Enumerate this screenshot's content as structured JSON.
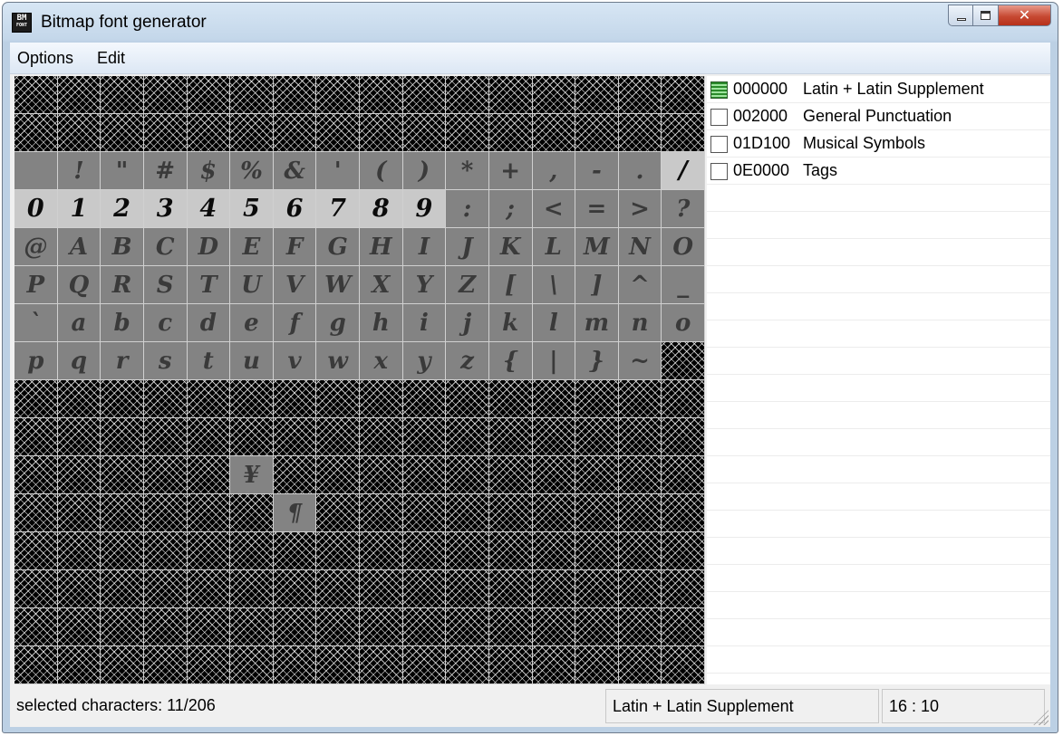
{
  "window": {
    "title": "Bitmap font generator",
    "icon_text_top": "BM",
    "icon_text_bottom": "FONT"
  },
  "menu": [
    "Options",
    "Edit"
  ],
  "grid": {
    "rows": [
      {
        "cells": [
          [
            "",
            ""
          ],
          [
            "",
            ""
          ],
          [
            "",
            ""
          ],
          [
            "",
            ""
          ],
          [
            "",
            ""
          ],
          [
            "",
            ""
          ],
          [
            "",
            ""
          ],
          [
            "",
            ""
          ],
          [
            "",
            ""
          ],
          [
            "",
            ""
          ],
          [
            "",
            ""
          ],
          [
            "",
            ""
          ],
          [
            "",
            ""
          ],
          [
            "",
            ""
          ],
          [
            "",
            ""
          ],
          [
            "",
            ""
          ]
        ]
      },
      {
        "cells": [
          [
            "",
            ""
          ],
          [
            "",
            ""
          ],
          [
            "",
            ""
          ],
          [
            "",
            ""
          ],
          [
            "",
            ""
          ],
          [
            "",
            ""
          ],
          [
            "",
            ""
          ],
          [
            "",
            ""
          ],
          [
            "",
            ""
          ],
          [
            "",
            ""
          ],
          [
            "",
            ""
          ],
          [
            "",
            ""
          ],
          [
            "",
            ""
          ],
          [
            "",
            ""
          ],
          [
            "",
            ""
          ],
          [
            "",
            ""
          ]
        ]
      },
      {
        "cells": [
          [
            "a",
            " "
          ],
          [
            "a",
            "!"
          ],
          [
            "a",
            "\""
          ],
          [
            "a",
            "#"
          ],
          [
            "a",
            "$"
          ],
          [
            "a",
            "%"
          ],
          [
            "a",
            "&"
          ],
          [
            "a",
            "'"
          ],
          [
            "a",
            "("
          ],
          [
            "a",
            ")"
          ],
          [
            "a",
            "*"
          ],
          [
            "a",
            "+"
          ],
          [
            "a",
            ","
          ],
          [
            "a",
            "-"
          ],
          [
            "a",
            "."
          ],
          [
            "s",
            "/"
          ]
        ]
      },
      {
        "cells": [
          [
            "s",
            "0"
          ],
          [
            "s",
            "1"
          ],
          [
            "s",
            "2"
          ],
          [
            "s",
            "3"
          ],
          [
            "s",
            "4"
          ],
          [
            "s",
            "5"
          ],
          [
            "s",
            "6"
          ],
          [
            "s",
            "7"
          ],
          [
            "s",
            "8"
          ],
          [
            "s",
            "9"
          ],
          [
            "a",
            ":"
          ],
          [
            "a",
            ";"
          ],
          [
            "a",
            "<"
          ],
          [
            "a",
            "="
          ],
          [
            "a",
            ">"
          ],
          [
            "a",
            "?"
          ]
        ]
      },
      {
        "cells": [
          [
            "a",
            "@"
          ],
          [
            "a",
            "A"
          ],
          [
            "a",
            "B"
          ],
          [
            "a",
            "C"
          ],
          [
            "a",
            "D"
          ],
          [
            "a",
            "E"
          ],
          [
            "a",
            "F"
          ],
          [
            "a",
            "G"
          ],
          [
            "a",
            "H"
          ],
          [
            "a",
            "I"
          ],
          [
            "a",
            "J"
          ],
          [
            "a",
            "K"
          ],
          [
            "a",
            "L"
          ],
          [
            "a",
            "M"
          ],
          [
            "a",
            "N"
          ],
          [
            "a",
            "O"
          ]
        ]
      },
      {
        "cells": [
          [
            "a",
            "P"
          ],
          [
            "a",
            "Q"
          ],
          [
            "a",
            "R"
          ],
          [
            "a",
            "S"
          ],
          [
            "a",
            "T"
          ],
          [
            "a",
            "U"
          ],
          [
            "a",
            "V"
          ],
          [
            "a",
            "W"
          ],
          [
            "a",
            "X"
          ],
          [
            "a",
            "Y"
          ],
          [
            "a",
            "Z"
          ],
          [
            "a",
            "["
          ],
          [
            "a",
            "\\"
          ],
          [
            "a",
            "]"
          ],
          [
            "a",
            "^"
          ],
          [
            "a",
            "_"
          ]
        ]
      },
      {
        "cells": [
          [
            "a",
            "`"
          ],
          [
            "a",
            "a"
          ],
          [
            "a",
            "b"
          ],
          [
            "a",
            "c"
          ],
          [
            "a",
            "d"
          ],
          [
            "a",
            "e"
          ],
          [
            "a",
            "f"
          ],
          [
            "a",
            "g"
          ],
          [
            "a",
            "h"
          ],
          [
            "a",
            "i"
          ],
          [
            "a",
            "j"
          ],
          [
            "a",
            "k"
          ],
          [
            "a",
            "l"
          ],
          [
            "a",
            "m"
          ],
          [
            "a",
            "n"
          ],
          [
            "a",
            "o"
          ]
        ]
      },
      {
        "cells": [
          [
            "a",
            "p"
          ],
          [
            "a",
            "q"
          ],
          [
            "a",
            "r"
          ],
          [
            "a",
            "s"
          ],
          [
            "a",
            "t"
          ],
          [
            "a",
            "u"
          ],
          [
            "a",
            "v"
          ],
          [
            "a",
            "w"
          ],
          [
            "a",
            "x"
          ],
          [
            "a",
            "y"
          ],
          [
            "a",
            "z"
          ],
          [
            "a",
            "{"
          ],
          [
            "a",
            "|"
          ],
          [
            "a",
            "}"
          ],
          [
            "a",
            "~"
          ],
          [
            "",
            ""
          ]
        ]
      },
      {
        "cells": [
          [
            "",
            ""
          ],
          [
            "",
            ""
          ],
          [
            "",
            ""
          ],
          [
            "",
            ""
          ],
          [
            "",
            ""
          ],
          [
            "",
            ""
          ],
          [
            "",
            ""
          ],
          [
            "",
            ""
          ],
          [
            "",
            ""
          ],
          [
            "",
            ""
          ],
          [
            "",
            ""
          ],
          [
            "",
            ""
          ],
          [
            "",
            ""
          ],
          [
            "",
            ""
          ],
          [
            "",
            ""
          ],
          [
            "",
            ""
          ]
        ]
      },
      {
        "cells": [
          [
            "",
            ""
          ],
          [
            "",
            ""
          ],
          [
            "",
            ""
          ],
          [
            "",
            ""
          ],
          [
            "",
            ""
          ],
          [
            "",
            ""
          ],
          [
            "",
            ""
          ],
          [
            "",
            ""
          ],
          [
            "",
            ""
          ],
          [
            "",
            ""
          ],
          [
            "",
            ""
          ],
          [
            "",
            ""
          ],
          [
            "",
            ""
          ],
          [
            "",
            ""
          ],
          [
            "",
            ""
          ],
          [
            "",
            ""
          ]
        ]
      },
      {
        "cells": [
          [
            "",
            ""
          ],
          [
            "",
            ""
          ],
          [
            "",
            ""
          ],
          [
            "",
            ""
          ],
          [
            "",
            ""
          ],
          [
            "a",
            "¥"
          ],
          [
            "",
            ""
          ],
          [
            "",
            ""
          ],
          [
            "",
            ""
          ],
          [
            "",
            ""
          ],
          [
            "",
            ""
          ],
          [
            "",
            ""
          ],
          [
            "",
            ""
          ],
          [
            "",
            ""
          ],
          [
            "",
            ""
          ],
          [
            "",
            ""
          ]
        ]
      },
      {
        "cells": [
          [
            "",
            ""
          ],
          [
            "",
            ""
          ],
          [
            "",
            ""
          ],
          [
            "",
            ""
          ],
          [
            "",
            ""
          ],
          [
            "",
            ""
          ],
          [
            "a",
            "¶"
          ],
          [
            "",
            ""
          ],
          [
            "",
            ""
          ],
          [
            "",
            ""
          ],
          [
            "",
            ""
          ],
          [
            "",
            ""
          ],
          [
            "",
            ""
          ],
          [
            "",
            ""
          ],
          [
            "",
            ""
          ],
          [
            "",
            ""
          ]
        ]
      },
      {
        "cells": [
          [
            "",
            ""
          ],
          [
            "",
            ""
          ],
          [
            "",
            ""
          ],
          [
            "",
            ""
          ],
          [
            "",
            ""
          ],
          [
            "",
            ""
          ],
          [
            "",
            ""
          ],
          [
            "",
            ""
          ],
          [
            "",
            ""
          ],
          [
            "",
            ""
          ],
          [
            "",
            ""
          ],
          [
            "",
            ""
          ],
          [
            "",
            ""
          ],
          [
            "",
            ""
          ],
          [
            "",
            ""
          ],
          [
            "",
            ""
          ]
        ]
      },
      {
        "cells": [
          [
            "",
            ""
          ],
          [
            "",
            ""
          ],
          [
            "",
            ""
          ],
          [
            "",
            ""
          ],
          [
            "",
            ""
          ],
          [
            "",
            ""
          ],
          [
            "",
            ""
          ],
          [
            "",
            ""
          ],
          [
            "",
            ""
          ],
          [
            "",
            ""
          ],
          [
            "",
            ""
          ],
          [
            "",
            ""
          ],
          [
            "",
            ""
          ],
          [
            "",
            ""
          ],
          [
            "",
            ""
          ],
          [
            "",
            ""
          ]
        ]
      },
      {
        "cells": [
          [
            "",
            ""
          ],
          [
            "",
            ""
          ],
          [
            "",
            ""
          ],
          [
            "",
            ""
          ],
          [
            "",
            ""
          ],
          [
            "",
            ""
          ],
          [
            "",
            ""
          ],
          [
            "",
            ""
          ],
          [
            "",
            ""
          ],
          [
            "",
            ""
          ],
          [
            "",
            ""
          ],
          [
            "",
            ""
          ],
          [
            "",
            ""
          ],
          [
            "",
            ""
          ],
          [
            "",
            ""
          ],
          [
            "",
            ""
          ]
        ]
      },
      {
        "cells": [
          [
            "",
            ""
          ],
          [
            "",
            ""
          ],
          [
            "",
            ""
          ],
          [
            "",
            ""
          ],
          [
            "",
            ""
          ],
          [
            "",
            ""
          ],
          [
            "",
            ""
          ],
          [
            "",
            ""
          ],
          [
            "",
            ""
          ],
          [
            "",
            ""
          ],
          [
            "",
            ""
          ],
          [
            "",
            ""
          ],
          [
            "",
            ""
          ],
          [
            "",
            ""
          ],
          [
            "",
            ""
          ],
          [
            "",
            ""
          ]
        ]
      }
    ]
  },
  "subsets": [
    {
      "code": "000000",
      "name": "Latin + Latin Supplement",
      "state": "partial"
    },
    {
      "code": "002000",
      "name": "General Punctuation",
      "state": "unchecked"
    },
    {
      "code": "01D100",
      "name": "Musical Symbols",
      "state": "unchecked"
    },
    {
      "code": "0E0000",
      "name": "Tags",
      "state": "unchecked"
    }
  ],
  "status": {
    "selected": "selected characters: 11/206",
    "subset": "Latin + Latin Supplement",
    "position": "16 : 10"
  }
}
